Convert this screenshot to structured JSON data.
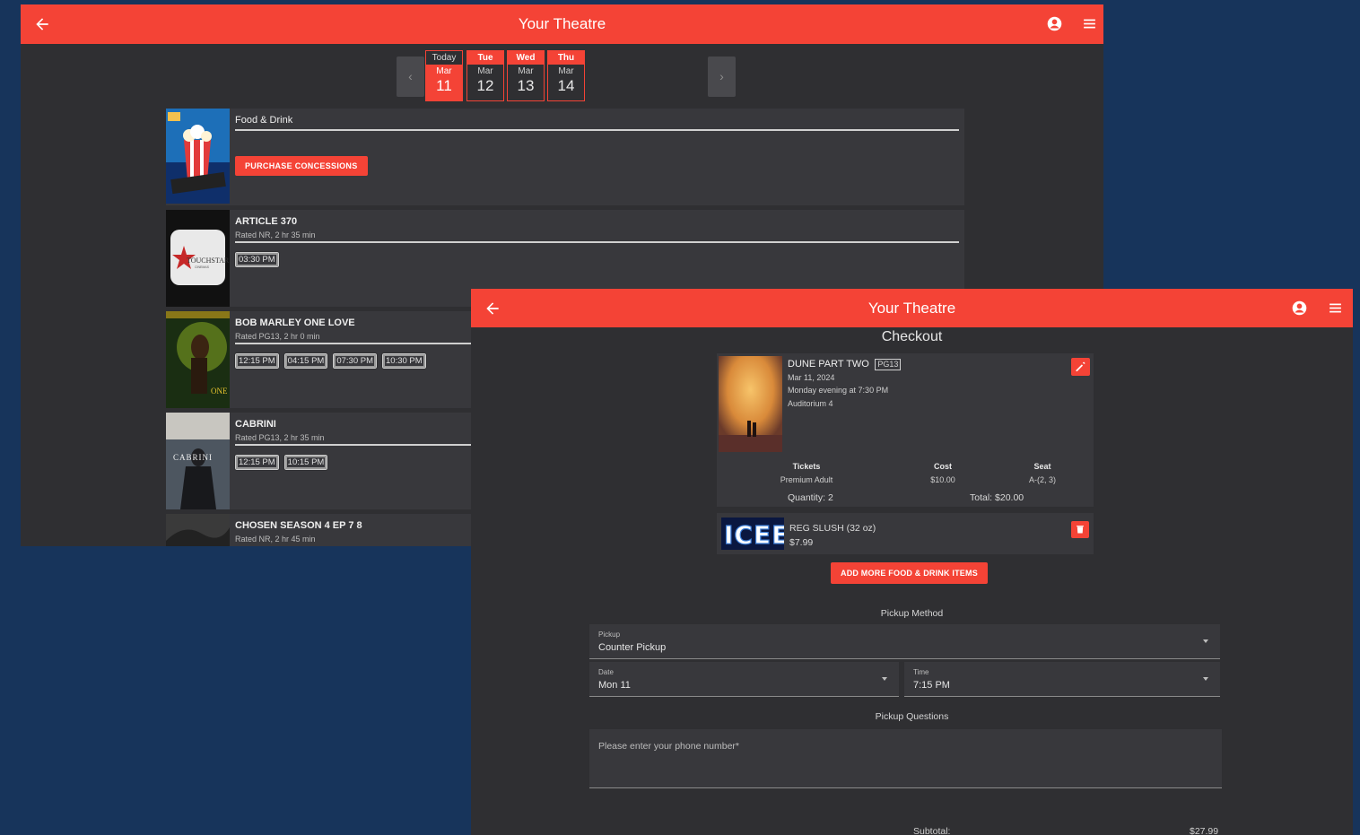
{
  "colors": {
    "accent": "#f44336",
    "background": "#17345b",
    "surface": "#2f2f32"
  },
  "schedule_window": {
    "app_title": "Your Theatre",
    "icons": {
      "back": "arrow-left-icon",
      "account": "account-circle-icon",
      "menu": "hamburger-menu-icon"
    },
    "date_nav": {
      "prev": "‹",
      "next": "›"
    },
    "dates": [
      {
        "dow": "Today",
        "month": "Mar",
        "day": "11",
        "selected": true
      },
      {
        "dow": "Tue",
        "month": "Mar",
        "day": "12",
        "selected": false
      },
      {
        "dow": "Wed",
        "month": "Mar",
        "day": "13",
        "selected": false
      },
      {
        "dow": "Thu",
        "month": "Mar",
        "day": "14",
        "selected": false
      }
    ],
    "food_drink": {
      "title": "Food & Drink",
      "button": "PURCHASE CONCESSIONS"
    },
    "movies": [
      {
        "title": "ARTICLE 370",
        "rating": "Rated NR, 2 hr 35 min",
        "times": [
          "03:30 PM"
        ]
      },
      {
        "title": "BOB MARLEY ONE LOVE",
        "rating": "Rated PG13, 2 hr 0 min",
        "times": [
          "12:15 PM",
          "04:15 PM",
          "07:30 PM",
          "10:30 PM"
        ]
      },
      {
        "title": "CABRINI",
        "rating": "Rated PG13, 2 hr 35 min",
        "times": [
          "12:15 PM",
          "10:15 PM"
        ]
      },
      {
        "title": "CHOSEN SEASON 4 EP 7 8",
        "rating": "Rated NR, 2 hr 45 min",
        "times": []
      }
    ],
    "poster_text": {
      "touchstar": "TOUCHSTAR",
      "touchstar_sub": "CINEMAS",
      "bob_marley": "ONE LOVE",
      "cabrini": "CABRINI"
    }
  },
  "checkout_window": {
    "app_title": "Your Theatre",
    "heading": "Checkout",
    "ticket": {
      "movie": "DUNE PART TWO",
      "rating_badge": "PG13",
      "date": "Mar 11, 2024",
      "showtime": "Monday evening at 7:30 PM",
      "auditorium": "Auditorium 4",
      "headers": {
        "tickets": "Tickets",
        "cost": "Cost",
        "seat": "Seat"
      },
      "ticket_type": "Premium Adult",
      "cost": "$10.00",
      "seat": "A-(2, 3)",
      "quantity": "Quantity: 2",
      "total": "Total: $20.00"
    },
    "food_item": {
      "name": "REG SLUSH (32 oz)",
      "price": "$7.99",
      "logo": "ICEE"
    },
    "add_more_button": "ADD MORE FOOD & DRINK ITEMS",
    "pickup": {
      "section_title": "Pickup Method",
      "method_label": "Pickup",
      "method_value": "Counter Pickup",
      "date_label": "Date",
      "date_value": "Mon 11",
      "time_label": "Time",
      "time_value": "7:15 PM"
    },
    "questions": {
      "section_title": "Pickup Questions",
      "phone_placeholder": "Please enter your phone number*"
    },
    "subtotal": {
      "label": "Subtotal:",
      "value": "$27.99"
    }
  }
}
